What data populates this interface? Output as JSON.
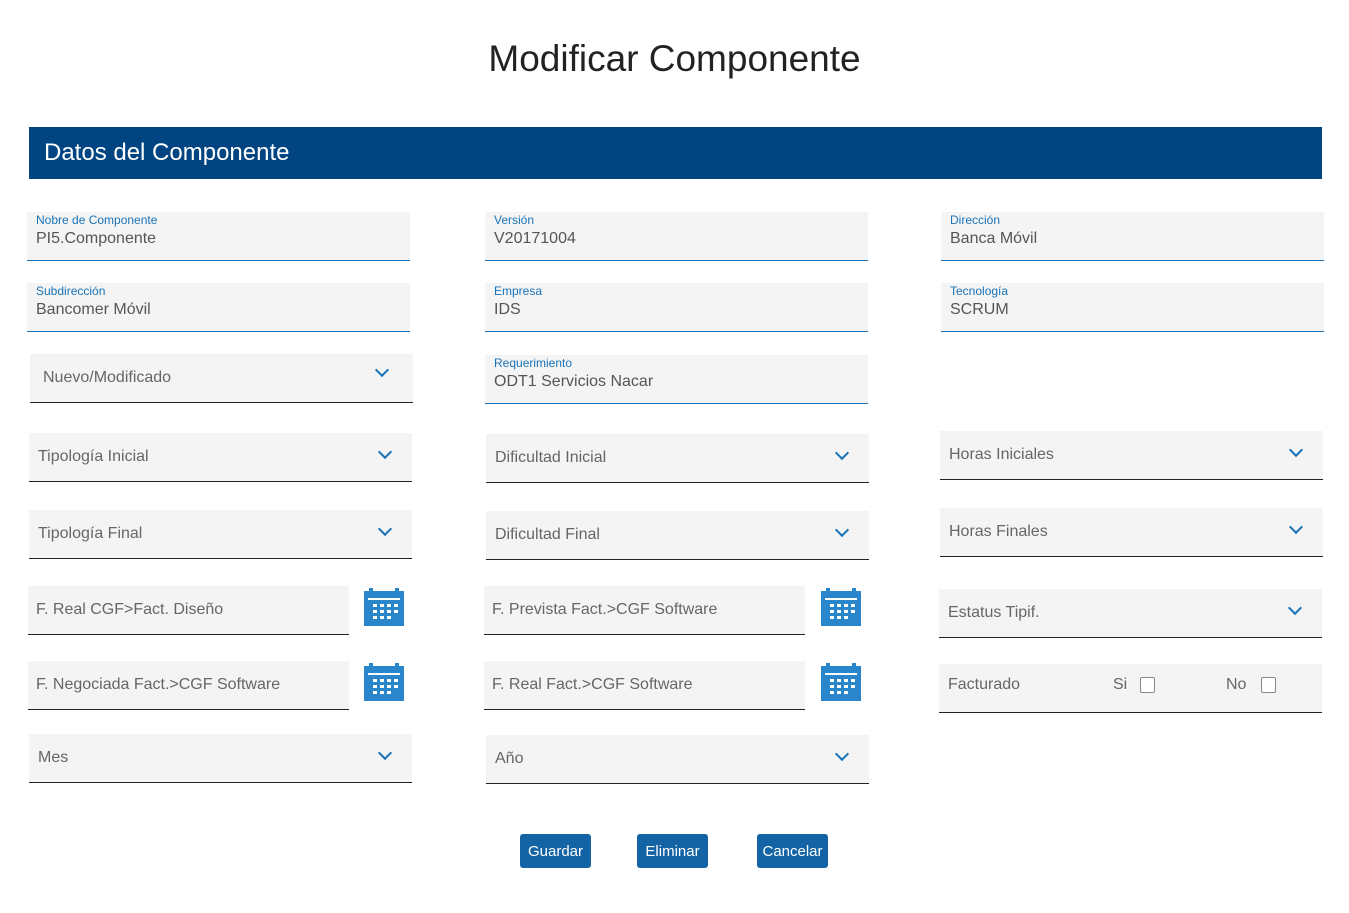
{
  "title": "Modificar Componente",
  "section": "Datos del Componente",
  "text_fields": {
    "nombre": {
      "label": "Nobre de Componente",
      "value": "PI5.Componente"
    },
    "version": {
      "label": "Versión",
      "value": "V20171004"
    },
    "direccion": {
      "label": "Dirección",
      "value": "Banca Móvil"
    },
    "subdireccion": {
      "label": "Subdirección",
      "value": "Bancomer Móvil"
    },
    "empresa": {
      "label": "Empresa",
      "value": "IDS"
    },
    "tecnologia": {
      "label": "Tecnología",
      "value": "SCRUM"
    },
    "requerimiento": {
      "label": "Requerimiento",
      "value": "ODT1 Servicios Nacar"
    }
  },
  "selects": {
    "nuevo": "Nuevo/Modificado",
    "tipologia_inicial": "Tipología Inicial",
    "dificultad_inicial": "Dificultad Inicial",
    "horas_iniciales": "Horas Iniciales",
    "tipologia_final": "Tipología Final",
    "dificultad_final": "Dificultad Final",
    "horas_finales": "Horas Finales",
    "estatus": "Estatus Tipif.",
    "mes": "Mes",
    "anio": "Año"
  },
  "dates": {
    "real_cgf": "F. Real CGF>Fact. Diseño",
    "prevista": "F. Prevista Fact.>CGF Software",
    "negociada": "F. Negociada Fact.>CGF Software",
    "real_fact": "F. Real Fact.>CGF Software"
  },
  "facturado": {
    "label": "Facturado",
    "si": "Si",
    "no": "No"
  },
  "buttons": {
    "guardar": "Guardar",
    "eliminar": "Eliminar",
    "cancelar": "Cancelar"
  },
  "colors": {
    "header": "#004481",
    "accent": "#1973b8",
    "button": "#1464a5"
  }
}
